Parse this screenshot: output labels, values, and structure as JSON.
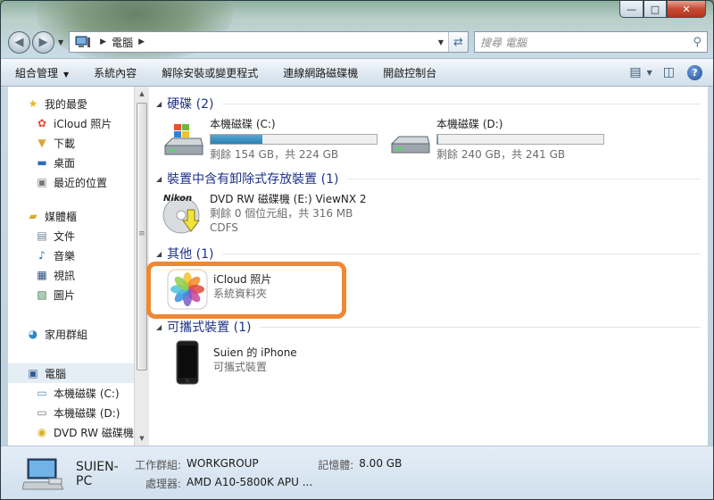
{
  "window": {
    "caption_buttons": {
      "minimize": "—",
      "maximize": "□",
      "close": "✕"
    }
  },
  "address": {
    "path": "電腦",
    "search_placeholder": "搜尋 電腦"
  },
  "toolbar": {
    "organize": "組合管理",
    "system_properties": "系統內容",
    "uninstall": "解除安裝或變更程式",
    "map_drive": "連線網路磁碟機",
    "control_panel": "開啟控制台",
    "help": "?"
  },
  "sidebar": {
    "favorites": "我的最愛",
    "icloud": "iCloud 照片",
    "downloads": "下載",
    "desktop": "桌面",
    "recent": "最近的位置",
    "libraries": "媒體櫃",
    "documents": "文件",
    "music": "音樂",
    "videos": "視訊",
    "pictures": "圖片",
    "homegroup": "家用群組",
    "computer": "電腦",
    "drive_c": "本機磁碟 (C:)",
    "drive_d": "本機磁碟 (D:)",
    "dvd": "DVD RW 磁碟機"
  },
  "groups": {
    "hard_disks": "硬碟 (2)",
    "removable": "裝置中含有卸除式存放裝置 (1)",
    "other": "其他 (1)",
    "portable": "可攜式裝置 (1)"
  },
  "drives": {
    "c": {
      "name": "本機磁碟 (C:)",
      "free": "剩餘 154 GB，共 224 GB",
      "used_fraction": 0.31
    },
    "d": {
      "name": "本機磁碟 (D:)",
      "free": "剩餘 240 GB，共 241 GB",
      "used_fraction": 0.004
    },
    "dvd": {
      "name": "DVD RW 磁碟機 (E:) ViewNX 2",
      "free": "剩餘 0 個位元組，共 316 MB",
      "fs": "CDFS",
      "brand": "Nikon"
    }
  },
  "other_items": {
    "icloud": {
      "name": "iCloud 照片",
      "type": "系統資料夾"
    }
  },
  "portable_items": {
    "iphone": {
      "name": "Suien 的 iPhone",
      "type": "可攜式裝置"
    }
  },
  "status": {
    "pc_name": "SUIEN-PC",
    "workgroup_label": "工作群組:",
    "workgroup": "WORKGROUP",
    "memory_label": "記憶體:",
    "memory": "8.00 GB",
    "cpu_label": "處理器:",
    "cpu": "AMD A10-5800K APU ..."
  },
  "colors": {
    "accent_highlight": "#f08733",
    "group_heading": "#1e3287",
    "drive_bar": "#2a7fb3"
  }
}
